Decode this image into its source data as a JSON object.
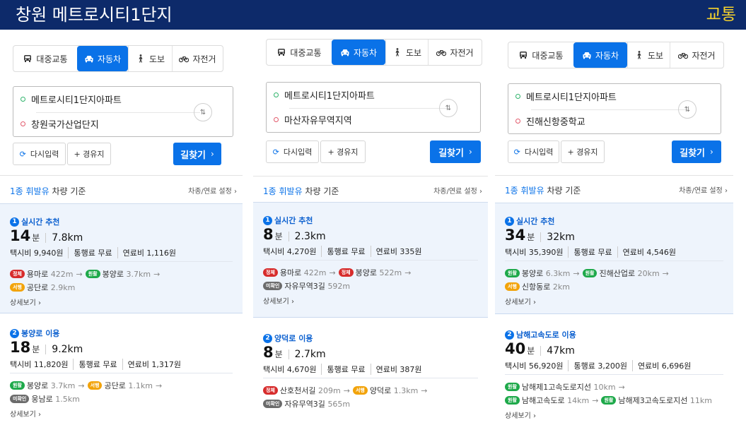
{
  "header": {
    "title": "창원 메트로시티1단지",
    "tag": "교통"
  },
  "panels": [
    {
      "tabs": [
        "대중교통",
        "자동차",
        "도보",
        "자전거"
      ],
      "active_tab": 1,
      "origin": "메트로시티1단지아파트",
      "destination": "창원국가산업단지",
      "reset_label": "다시입력",
      "waypoint_label": "+ 경유지",
      "find_label": "길찾기",
      "basis": {
        "blue": "1종 휘발유",
        "rest": " 차량 기준"
      },
      "vehicle_setting": "차종/연료 설정",
      "routes": [
        {
          "num": "1",
          "title": "실시간 추천",
          "time": "14",
          "unit": "분",
          "dist": "7.8km",
          "costs": [
            "택시비 9,940원",
            "통행료 무료",
            "연료비 1,116원"
          ],
          "rows": [
            [
              {
                "badge": "정체",
                "color": "red",
                "road": "용마로",
                "len": "422m"
              },
              {
                "badge": "원활",
                "color": "green",
                "road": "봉양로",
                "len": "3.7km"
              }
            ],
            [
              {
                "badge": "서행",
                "color": "orange",
                "road": "공단로",
                "len": "2.9km"
              }
            ]
          ],
          "detail": "상세보기"
        },
        {
          "num": "2",
          "title": "봉양로 이용",
          "time": "18",
          "unit": "분",
          "dist": "9.2km",
          "costs": [
            "택시비 11,820원",
            "통행료 무료",
            "연료비 1,317원"
          ],
          "rows": [
            [
              {
                "badge": "원활",
                "color": "green",
                "road": "봉양로",
                "len": "3.7km"
              },
              {
                "badge": "서행",
                "color": "orange",
                "road": "공단로",
                "len": "1.1km"
              }
            ],
            [
              {
                "badge": "미확인",
                "color": "gray",
                "road": "웅남로",
                "len": "1.5km"
              }
            ]
          ],
          "detail": "상세보기"
        }
      ]
    },
    {
      "tabs": [
        "대중교통",
        "자동차",
        "도보",
        "자전거"
      ],
      "active_tab": 1,
      "origin": "메트로시티1단지아파트",
      "destination": "마산자유무역지역",
      "reset_label": "다시입력",
      "waypoint_label": "+ 경유지",
      "find_label": "길찾기",
      "basis": {
        "blue": "1종 휘발유",
        "rest": " 차량 기준"
      },
      "vehicle_setting": "차종/연료 설정",
      "routes": [
        {
          "num": "1",
          "title": "실시간 추천",
          "time": "8",
          "unit": "분",
          "dist": "2.3km",
          "costs": [
            "택시비 4,270원",
            "통행료 무료",
            "연료비 335원"
          ],
          "rows": [
            [
              {
                "badge": "정체",
                "color": "red",
                "road": "용마로",
                "len": "422m"
              },
              {
                "badge": "정체",
                "color": "red",
                "road": "봉양로",
                "len": "522m"
              }
            ],
            [
              {
                "badge": "미확인",
                "color": "gray",
                "road": "자유무역3길",
                "len": "592m"
              }
            ]
          ],
          "detail": "상세보기"
        },
        {
          "num": "2",
          "title": "양덕로 이용",
          "time": "8",
          "unit": "분",
          "dist": "2.7km",
          "costs": [
            "택시비 4,670원",
            "통행료 무료",
            "연료비 387원"
          ],
          "rows": [
            [
              {
                "badge": "정체",
                "color": "red",
                "road": "산호천서길",
                "len": "209m"
              },
              {
                "badge": "서행",
                "color": "orange",
                "road": "양덕로",
                "len": "1.3km"
              }
            ],
            [
              {
                "badge": "미확인",
                "color": "gray",
                "road": "자유무역3길",
                "len": "565m"
              }
            ]
          ],
          "detail": ""
        }
      ]
    },
    {
      "tabs": [
        "대중교통",
        "자동차",
        "도보",
        "자전거"
      ],
      "active_tab": 1,
      "origin": "메트로시티1단지아파트",
      "destination": "진해신항중학교",
      "reset_label": "다시입력",
      "waypoint_label": "+ 경유지",
      "find_label": "길찾기",
      "basis": {
        "blue": "1종 휘발유",
        "rest": " 차량 기준"
      },
      "vehicle_setting": "차종/연료 설정",
      "routes": [
        {
          "num": "1",
          "title": "실시간 추천",
          "time": "34",
          "unit": "분",
          "dist": "32km",
          "costs": [
            "택시비 35,390원",
            "통행료 무료",
            "연료비 4,546원"
          ],
          "rows": [
            [
              {
                "badge": "원활",
                "color": "green",
                "road": "봉양로",
                "len": "6.3km"
              },
              {
                "badge": "원활",
                "color": "green",
                "road": "진해산업로",
                "len": "20km"
              }
            ],
            [
              {
                "badge": "서행",
                "color": "orange",
                "road": "신항동로",
                "len": "2km"
              }
            ]
          ],
          "detail": "상세보기"
        },
        {
          "num": "2",
          "title": "남해고속도로 이용",
          "time": "40",
          "unit": "분",
          "dist": "47km",
          "costs": [
            "택시비 56,920원",
            "통행료 3,200원",
            "연료비 6,696원"
          ],
          "rows": [
            [
              {
                "badge": "원활",
                "color": "green",
                "road": "남해제1고속도로지선",
                "len": "10km"
              }
            ],
            [
              {
                "badge": "원활",
                "color": "green",
                "road": "남해고속도로",
                "len": "14km"
              },
              {
                "badge": "원활",
                "color": "green",
                "road": "남해제3고속도로지선",
                "len": "11km"
              }
            ]
          ],
          "detail": "상세보기"
        }
      ]
    }
  ]
}
